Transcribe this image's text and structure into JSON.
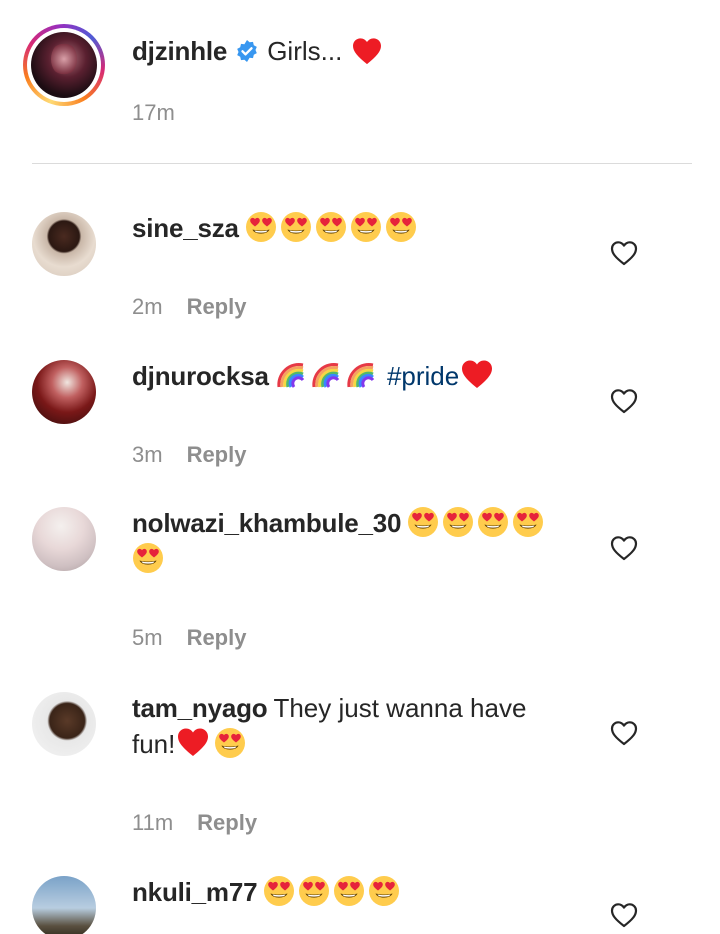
{
  "caption": {
    "username": "djzinhle",
    "text": "Girls...",
    "time": "17m",
    "verified_color": "#3897f0",
    "heart_color": "#ed1c24"
  },
  "comments": [
    {
      "username": "sine_sza",
      "text": "",
      "emojis": [
        "heart-eyes",
        "heart-eyes",
        "heart-eyes",
        "heart-eyes",
        "heart-eyes"
      ],
      "time": "2m",
      "reply": "Reply"
    },
    {
      "username": "djnurocksa",
      "text": "#pride",
      "emojis": [
        "rainbow",
        "rainbow",
        "rainbow"
      ],
      "trailing": [
        "red-heart"
      ],
      "time": "3m",
      "reply": "Reply"
    },
    {
      "username": "nolwazi_khambule_30",
      "text": "",
      "emojis": [
        "heart-eyes",
        "heart-eyes",
        "heart-eyes",
        "heart-eyes",
        "heart-eyes"
      ],
      "time": "5m",
      "reply": "Reply"
    },
    {
      "username": "tam_nyago",
      "text": "They just wanna have fun!",
      "trailing": [
        "red-heart",
        "heart-eyes"
      ],
      "time": "11m",
      "reply": "Reply"
    },
    {
      "username": "nkuli_m77",
      "text": "",
      "emojis": [
        "heart-eyes",
        "heart-eyes",
        "heart-eyes",
        "heart-eyes"
      ],
      "time": "",
      "reply": ""
    }
  ],
  "icons": {
    "like": "heart-outline-icon"
  }
}
